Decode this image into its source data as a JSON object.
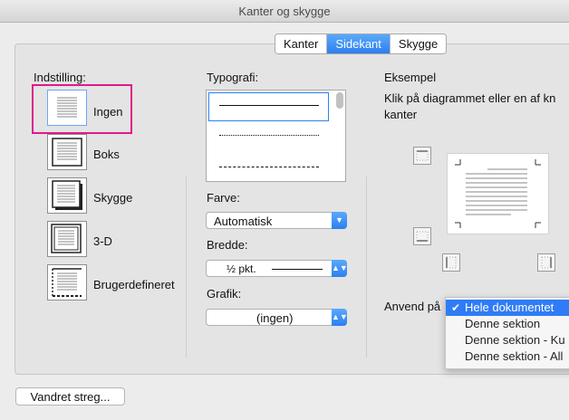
{
  "window": {
    "title": "Kanter og skygge"
  },
  "tabs": [
    {
      "label": "Kanter",
      "active": false
    },
    {
      "label": "Sidekant",
      "active": true
    },
    {
      "label": "Skygge",
      "active": false
    }
  ],
  "setting": {
    "heading": "Indstilling:",
    "options": [
      {
        "label": "Ingen",
        "selected": true
      },
      {
        "label": "Boks",
        "selected": false
      },
      {
        "label": "Skygge",
        "selected": false
      },
      {
        "label": "3-D",
        "selected": false
      },
      {
        "label": "Brugerdefineret",
        "selected": false
      }
    ]
  },
  "style": {
    "heading": "Typografi:",
    "line_styles": [
      "solid",
      "dotted",
      "dashed"
    ],
    "color_label": "Farve:",
    "color_value": "Automatisk",
    "width_label": "Bredde:",
    "width_value": "½ pkt.",
    "art_label": "Grafik:",
    "art_value": "(ingen)"
  },
  "preview": {
    "heading": "Eksempel",
    "instructions_line1": "Klik på diagrammet eller en af kn",
    "instructions_line2": "kanter"
  },
  "apply_to": {
    "label": "Anvend på",
    "options": [
      {
        "label": "Hele dokumentet",
        "selected": true
      },
      {
        "label": "Denne sektion",
        "selected": false
      },
      {
        "label": "Denne sektion - Ku",
        "selected": false
      },
      {
        "label": "Denne sektion - All",
        "selected": false
      }
    ]
  },
  "horizontal_line_button": "Vandret streg...",
  "colors": {
    "accent": "#2d7ff0",
    "highlight_outline": "#e0198b"
  }
}
